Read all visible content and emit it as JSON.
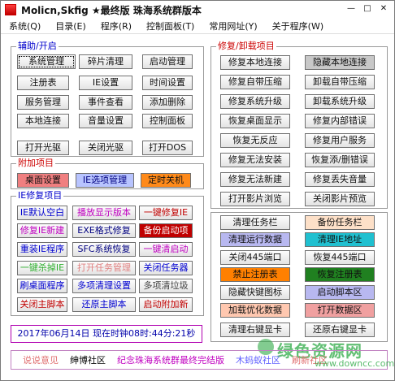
{
  "window": {
    "title": "Molicn,Skfig ★最终版 珠海系统群版本",
    "controls": [
      "—",
      "□",
      "✕"
    ]
  },
  "menu": [
    "系统(Q)",
    "目录(E)",
    "程序(R)",
    "控制面板(T)",
    "常用网址(Y)",
    "关于程序(W)"
  ],
  "group_assist": {
    "title": "辅助/开启",
    "buttons": [
      "系统管理",
      "碎片清理",
      "启动管理",
      "注册表",
      "IE设置",
      "时间设置",
      "服务管理",
      "事件查看",
      "添加删除",
      "本地连接",
      "音量设置",
      "控制面板",
      "打开光驱",
      "关闭光驱",
      "打开DOS"
    ]
  },
  "group_extra": {
    "title": "附加项目",
    "buttons": [
      "桌面设置",
      "IE选项管理",
      "定时关机"
    ]
  },
  "group_ie": {
    "title": "IE修复项目",
    "buttons": [
      "IE默认空白",
      "播放显示版本",
      "一键修复IE",
      "修复IE新建",
      "EXE格式修复",
      "备份启动项",
      "重装IE程序",
      "SFC系统恢复",
      "一键清启动",
      "一键杀掉IE",
      "打开任务管理",
      "关闭任务器",
      "刷桌面程序",
      "多项清理设置",
      "多项清垃圾",
      "关闭主脚本",
      "还原主脚本",
      "启动附加新"
    ]
  },
  "group_repair": {
    "title": "修复/卸载项目",
    "buttons": [
      "修复本地连接",
      "隐藏本地连接",
      "修复自带压缩",
      "卸载自带压缩",
      "修复系统升级",
      "卸载系统升级",
      "恢复桌面显示",
      "修复内部错误",
      "恢复无反应",
      "修复用户服务",
      "修复无法安装",
      "恢复添/删错误",
      "修复无法新建",
      "修复丢失音量",
      "打开影片浏览",
      "关闭影片预览"
    ]
  },
  "group_tools": {
    "buttons": [
      "清理任务栏",
      "备份任务栏",
      "清理运行数据",
      "清理IE地址",
      "关闭445端口",
      "恢复445端口",
      "禁止注册表",
      "恢复注册表",
      "隐藏快键图标",
      "启动脚本区",
      "加载优化数据",
      "打开数据区",
      "清理右键显卡",
      "还原右键显卡"
    ]
  },
  "status": "2017年06月14日  现在时钟08时:44分:21秒",
  "footer": [
    "说说意见",
    "绅博社区",
    "纪念珠海系统群最终完结版",
    "木蚂蚁社区",
    "刷新社区"
  ],
  "watermark": {
    "line1": "绿色资源网",
    "line2": "www.downcc.com"
  },
  "colors": {
    "accent_blue": "#0000cc",
    "title_red": "#cc0000"
  }
}
